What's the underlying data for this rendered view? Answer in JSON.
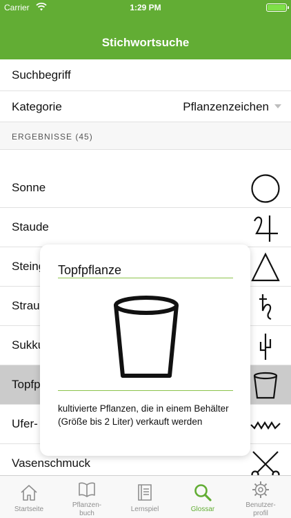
{
  "status_bar": {
    "carrier": "Carrier",
    "time": "1:29 PM",
    "battery_level": 1.0
  },
  "navbar": {
    "title": "Stichwortsuche"
  },
  "search": {
    "label": "Suchbegriff"
  },
  "category": {
    "label": "Kategorie",
    "value": "Pflanzenzeichen"
  },
  "section": {
    "label": "ERGEBNISSE (45)"
  },
  "results": [
    {
      "label": "Sonne",
      "symbol": "sun-circle-icon"
    },
    {
      "label": "Staude",
      "symbol": "perennial-symbol-icon"
    },
    {
      "label": "Steing",
      "symbol": "triangle-icon"
    },
    {
      "label": "Strau",
      "symbol": "shrub-symbol-icon"
    },
    {
      "label": "Sukku",
      "symbol": "cactus-icon"
    },
    {
      "label": "Topfp",
      "symbol": "pot-icon",
      "selected": true
    },
    {
      "label": "Ufer-",
      "symbol": "wave-icon"
    },
    {
      "label": "Vasenschmuck",
      "symbol": "scissors-icon"
    }
  ],
  "popup": {
    "title": "Topfpflanze",
    "icon": "pot-icon",
    "description": "kultivierte Pflanzen, die in einem Behälter (Größe bis 2 Liter) verkauft werden"
  },
  "tabs": [
    {
      "label": "Startseite",
      "icon": "home-icon"
    },
    {
      "label": "Pflanzen-\nbuch",
      "icon": "book-icon"
    },
    {
      "label": "Lernspiel",
      "icon": "notebook-icon"
    },
    {
      "label": "Glossar",
      "icon": "search-icon",
      "active": true
    },
    {
      "label": "Benutzer-\nprofil",
      "icon": "gear-icon"
    }
  ],
  "colors": {
    "accent": "#62ad34",
    "selected_row": "#cbcbcb",
    "rule": "#8bc34a",
    "tab_inactive": "#8e8e8e"
  }
}
